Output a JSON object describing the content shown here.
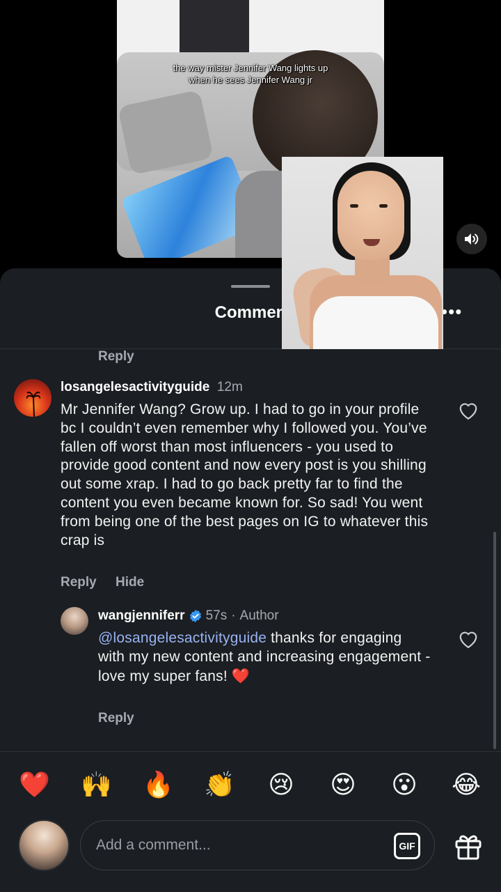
{
  "video": {
    "caption": "the way mister Jennifer Wang lights up when he sees Jennifer Wang jr",
    "volume_icon": "speaker-icon"
  },
  "sheet": {
    "title": "Commen",
    "more_icon": "more-horizontal-icon"
  },
  "comments": {
    "prev_reply_label": "Reply",
    "c1": {
      "username": "losangelesactivityguide",
      "time": "12m",
      "body": "Mr Jennifer Wang? Grow up. I had to go in your profile bc I couldn’t even remember why I followed you. You’ve fallen off worst than most influencers - you used to provide good content and now every post is you shilling out some xrap. I had to go back pretty far to find the content you even became known for. So sad! You went from being one of the best pages on IG to whatever this crap is",
      "reply_label": "Reply",
      "hide_label": "Hide"
    },
    "c2": {
      "username": "wangjenniferr",
      "time": "57s",
      "separator": "·",
      "author_label": "Author",
      "mention": "@losangelesactivityguide",
      "body": " thanks for engaging with my new content and increasing engagement - love my super fans! ",
      "emoji": "❤️",
      "reply_label": "Reply"
    }
  },
  "emoji_bar": [
    "❤️",
    "🙌",
    "🔥",
    "👏",
    "😢",
    "😍",
    "😮",
    "😂"
  ],
  "composer": {
    "placeholder": "Add a comment...",
    "gif_label": "GIF"
  },
  "colors": {
    "sheet_bg": "#1b1e22",
    "mention": "#98b3f3",
    "muted": "#a7abb1",
    "verified": "#3897f0"
  }
}
